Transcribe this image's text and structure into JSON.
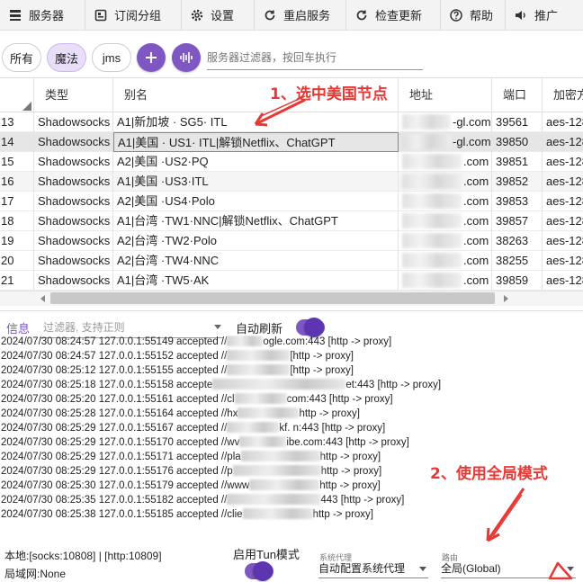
{
  "toolbar": {
    "items": [
      {
        "label": "服务器",
        "icon": "menu-icon"
      },
      {
        "label": "订阅分组",
        "icon": "subscription-icon"
      },
      {
        "label": "设置",
        "icon": "gear-icon"
      },
      {
        "label": "重启服务",
        "icon": "restart-icon"
      },
      {
        "label": "检查更新",
        "icon": "refresh-icon"
      },
      {
        "label": "帮助",
        "icon": "help-icon"
      },
      {
        "label": "推广",
        "icon": "speaker-icon"
      }
    ]
  },
  "filters": {
    "chips": [
      "所有",
      "魔法",
      "jms"
    ],
    "active_chip": "魔法",
    "search_placeholder": "服务器过滤器，按回车执行"
  },
  "table": {
    "headers": [
      "类型",
      "别名",
      "地址",
      "端口",
      "加密方"
    ],
    "rows": [
      {
        "num": "13",
        "type": "Shadowsocks",
        "alias": "A1|新加坡 · SG5· ITL",
        "addr": "-gl.com",
        "port": "39561",
        "enc": "aes-128"
      },
      {
        "num": "14",
        "type": "Shadowsocks",
        "alias": "A1|美国 · US1· ITL|解锁Netflix、ChatGPT",
        "addr": "-gl.com",
        "port": "39850",
        "enc": "aes-128"
      },
      {
        "num": "15",
        "type": "Shadowsocks",
        "alias": "A2|美国 ·US2·PQ",
        "addr": ".com",
        "port": "39851",
        "enc": "aes-128"
      },
      {
        "num": "16",
        "type": "Shadowsocks",
        "alias": "A1|美国 ·US3·ITL",
        "addr": ".com",
        "port": "39852",
        "enc": "aes-128"
      },
      {
        "num": "17",
        "type": "Shadowsocks",
        "alias": "A2|美国 ·US4·Polo",
        "addr": ".com",
        "port": "39853",
        "enc": "aes-128"
      },
      {
        "num": "18",
        "type": "Shadowsocks",
        "alias": "A1|台湾 ·TW1·NNC|解锁Netflix、ChatGPT",
        "addr": ".com",
        "port": "39857",
        "enc": "aes-128"
      },
      {
        "num": "19",
        "type": "Shadowsocks",
        "alias": "A2|台湾 ·TW2·Polo",
        "addr": ".com",
        "port": "38263",
        "enc": "aes-128"
      },
      {
        "num": "20",
        "type": "Shadowsocks",
        "alias": "A2|台湾 ·TW4·NNC",
        "addr": ".com",
        "port": "38255",
        "enc": "aes-128"
      },
      {
        "num": "21",
        "type": "Shadowsocks",
        "alias": "A1|台湾 ·TW5·AK",
        "addr": ".com",
        "port": "39859",
        "enc": "aes-128"
      }
    ],
    "selected_num": "14"
  },
  "log": {
    "tab_label": "信息",
    "filter_placeholder": "过滤器, 支持正则",
    "auto_refresh_label": "自动刷新",
    "lines": [
      {
        "prefix": "2024/07/30 08:24:57 127.0.0.1:55149 accepted //",
        "suffix": "ogle.com:443 [http -> proxy]"
      },
      {
        "prefix": "2024/07/30 08:24:57 127.0.0.1:55152 accepted //",
        "suffix": "[http -> proxy]"
      },
      {
        "prefix": "2024/07/30 08:25:12 127.0.0.1:55155 accepted //",
        "suffix": "[http -> proxy]"
      },
      {
        "prefix": "2024/07/30 08:25:18 127.0.0.1:55158 accepte",
        "suffix": "et:443 [http -> proxy]"
      },
      {
        "prefix": "2024/07/30 08:25:20 127.0.0.1:55161 accepted //cl",
        "suffix": "com:443 [http -> proxy]"
      },
      {
        "prefix": "2024/07/30 08:25:28 127.0.0.1:55164 accepted //hx",
        "suffix": "http -> proxy]"
      },
      {
        "prefix": "2024/07/30 08:25:29 127.0.0.1:55167 accepted //",
        "suffix": "kf.         n:443 [http -> proxy]"
      },
      {
        "prefix": "2024/07/30 08:25:29 127.0.0.1:55170 accepted //wv",
        "suffix": "ibe.com:443 [http -> proxy]"
      },
      {
        "prefix": "2024/07/30 08:25:29 127.0.0.1:55171 accepted //pla",
        "suffix": "http -> proxy]"
      },
      {
        "prefix": "2024/07/30 08:25:29 127.0.0.1:55176 accepted //p",
        "suffix": "http -> proxy]"
      },
      {
        "prefix": "2024/07/30 08:25:30 127.0.0.1:55179 accepted //www",
        "suffix": "http -> proxy]"
      },
      {
        "prefix": "2024/07/30 08:25:35 127.0.0.1:55182 accepted //",
        "suffix": "443 [http -> proxy]"
      },
      {
        "prefix": "2024/07/30 08:25:38 127.0.0.1:55185 accepted //clie",
        "suffix": "http -> proxy]"
      }
    ]
  },
  "status": {
    "local_ports": "本地:[socks:10808] | [http:10809]",
    "lan": "局域网:None",
    "tun_label": "启用Tun模式",
    "sys_proxy_label": "系统代理",
    "sys_proxy_value": "自动配置系统代理",
    "routing_label": "路由",
    "routing_value": "全局(Global)"
  },
  "annotations": {
    "step1": "1、选中美国节点",
    "step2": "2、使用全局模式"
  },
  "colors": {
    "accent": "#7e57c2",
    "annotation": "#e53935"
  }
}
